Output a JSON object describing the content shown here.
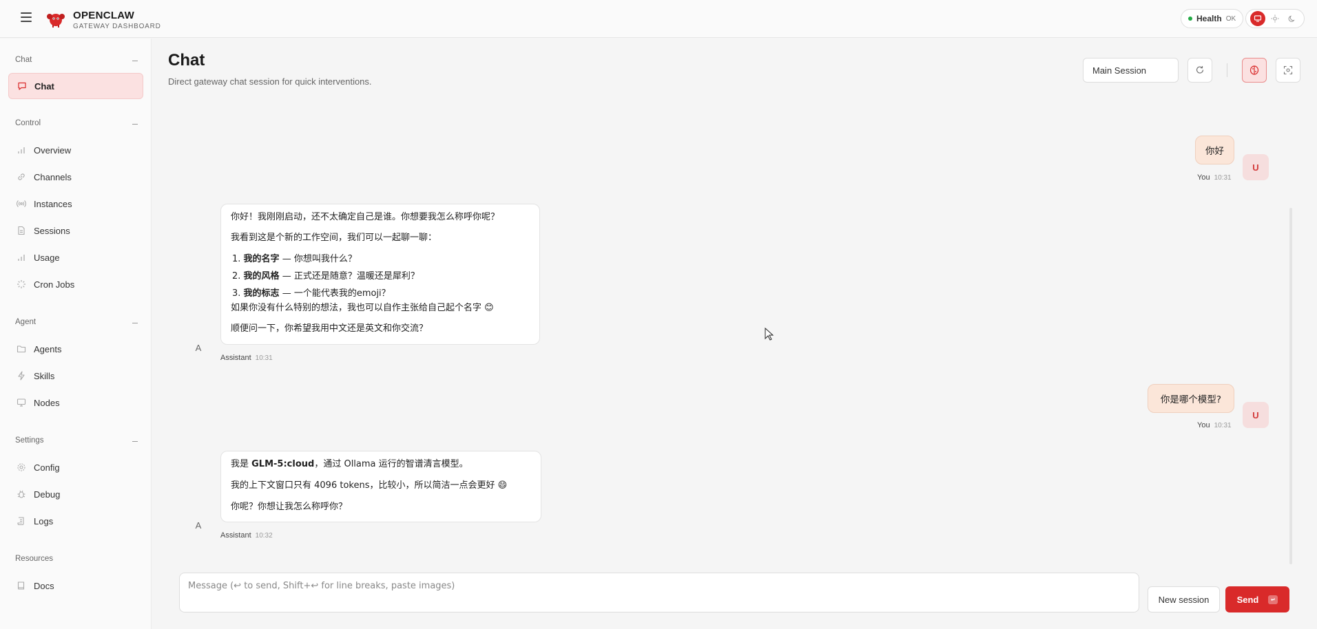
{
  "header": {
    "brand_name": "OPENCLAW",
    "brand_sub": "GATEWAY DASHBOARD",
    "health_label": "Health",
    "health_status": "OK",
    "health_color": "#22aa44",
    "accent_color": "#d92a2a"
  },
  "sidebar": {
    "sections": [
      {
        "title": "Chat",
        "items": [
          {
            "label": "Chat",
            "icon": "message-icon",
            "active": true
          }
        ]
      },
      {
        "title": "Control",
        "items": [
          {
            "label": "Overview",
            "icon": "bar-chart-icon"
          },
          {
            "label": "Channels",
            "icon": "link-icon"
          },
          {
            "label": "Instances",
            "icon": "radio-icon"
          },
          {
            "label": "Sessions",
            "icon": "document-icon"
          },
          {
            "label": "Usage",
            "icon": "bar-chart-icon"
          },
          {
            "label": "Cron Jobs",
            "icon": "loader-icon"
          }
        ]
      },
      {
        "title": "Agent",
        "items": [
          {
            "label": "Agents",
            "icon": "folder-icon"
          },
          {
            "label": "Skills",
            "icon": "bolt-icon"
          },
          {
            "label": "Nodes",
            "icon": "monitor-icon"
          }
        ]
      },
      {
        "title": "Settings",
        "items": [
          {
            "label": "Config",
            "icon": "gear-icon"
          },
          {
            "label": "Debug",
            "icon": "bug-icon"
          },
          {
            "label": "Logs",
            "icon": "scroll-icon"
          }
        ]
      },
      {
        "title": "Resources",
        "items": [
          {
            "label": "Docs",
            "icon": "book-icon"
          }
        ]
      }
    ]
  },
  "main": {
    "title": "Chat",
    "subtitle": "Direct gateway chat session for quick interventions.",
    "session_select": "Main Session"
  },
  "messages": [
    {
      "role": "user",
      "avatar": "U",
      "sender": "You",
      "time": "10:31",
      "text": "你好"
    },
    {
      "role": "assistant",
      "avatar": "A",
      "sender": "Assistant",
      "time": "10:31",
      "line1": "你好！我刚刚启动，还不太确定自己是谁。你想要我怎么称呼你呢？",
      "line2": "我看到这是个新的工作空间，我们可以一起聊一聊：",
      "list": [
        {
          "num": "1.",
          "bold": "我的名字",
          "rest": " — 你想叫我什么？"
        },
        {
          "num": "2.",
          "bold": "我的风格",
          "rest": " — 正式还是随意？温暖还是犀利？"
        },
        {
          "num": "3.",
          "bold": "我的标志",
          "rest": " — 一个能代表我的emoji？"
        }
      ],
      "line3": "如果你没有什么特别的想法，我也可以自作主张给自己起个名字 😊",
      "line4": "顺便问一下，你希望我用中文还是英文和你交流？"
    },
    {
      "role": "user",
      "avatar": "U",
      "sender": "You",
      "time": "10:31",
      "text": "你是哪个模型?"
    },
    {
      "role": "assistant",
      "avatar": "A",
      "sender": "Assistant",
      "time": "10:32",
      "line1_pre": "我是 ",
      "line1_bold": "GLM-5:cloud",
      "line1_post": "，通过 Ollama 运行的智谱清言模型。",
      "line2": "我的上下文窗口只有 4096 tokens，比较小，所以简洁一点会更好 😄",
      "line3": "你呢？你想让我怎么称呼你？"
    }
  ],
  "composer": {
    "placeholder": "Message (↩ to send, Shift+↩ for line breaks, paste images)",
    "new_session_label": "New session",
    "send_label": "Send",
    "send_kbd": "↵"
  }
}
